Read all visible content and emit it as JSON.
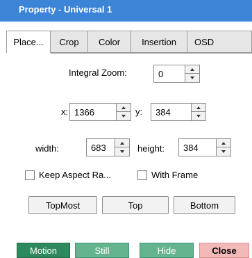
{
  "window": {
    "title": "Property - Universal  1"
  },
  "tabs": [
    {
      "label": "Place..."
    },
    {
      "label": "Crop"
    },
    {
      "label": "Color"
    },
    {
      "label": "Insertion"
    },
    {
      "label": "OSD"
    }
  ],
  "placement": {
    "integral_zoom": {
      "label": "Integral Zoom:",
      "value": "0"
    },
    "x": {
      "label": "x:",
      "value": "1366"
    },
    "y": {
      "label": "y:",
      "value": "384"
    },
    "width": {
      "label": "width:",
      "value": "683"
    },
    "height": {
      "label": "height:",
      "value": "384"
    },
    "keep_aspect_ratio": {
      "label": "Keep Aspect Ra...",
      "checked": false
    },
    "with_frame": {
      "label": "With Frame",
      "checked": false
    },
    "buttons": {
      "topmost": "TopMost",
      "top": "Top",
      "bottom": "Bottom"
    }
  },
  "bottom_bar": {
    "motion": "Motion",
    "still": "Still",
    "hide": "Hide",
    "close": "Close"
  },
  "colors": {
    "title_bar": "#3b84d6",
    "motion_button": "#2e8a5e",
    "still_button": "#62b58f",
    "hide_button": "#62b58f",
    "close_button": "#f3b9b9"
  }
}
